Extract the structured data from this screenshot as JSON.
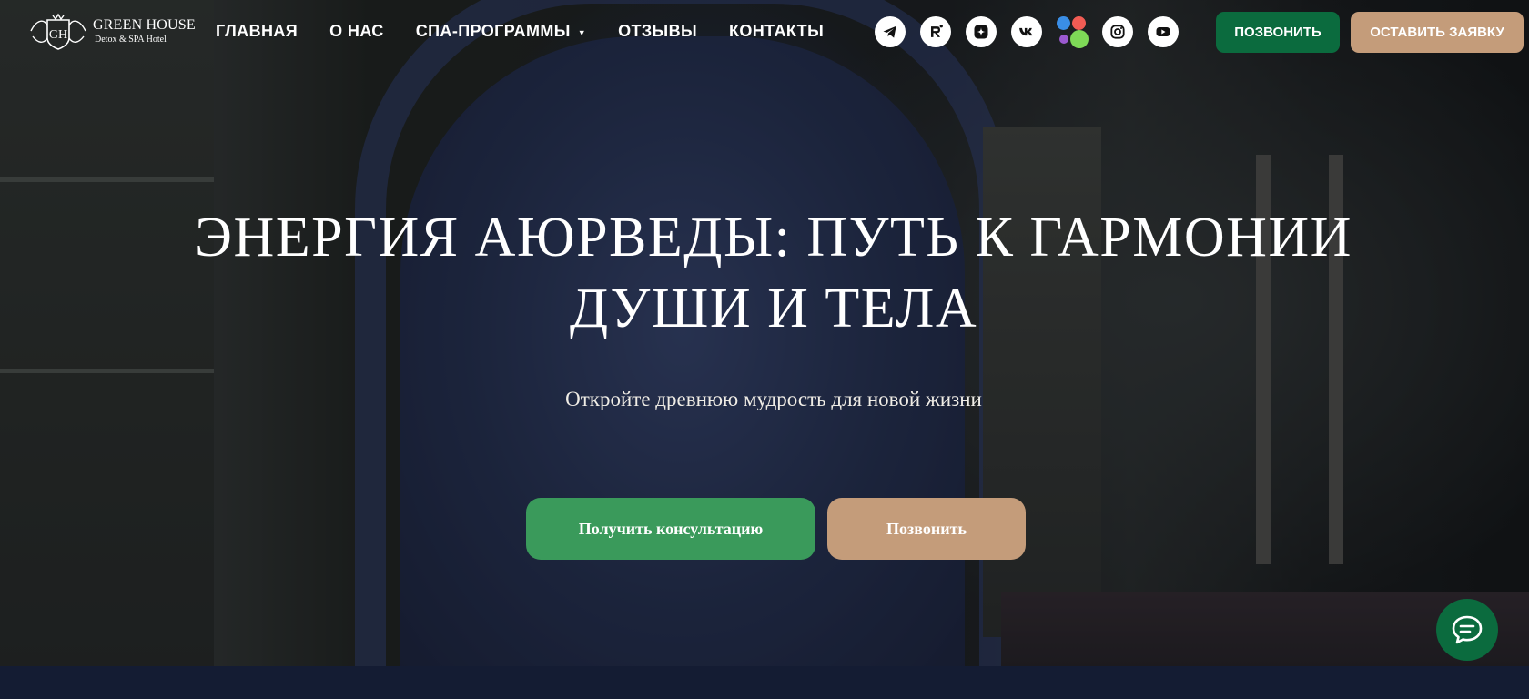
{
  "logo": {
    "name": "GREEN HOUSE",
    "subtitle": "Detox & SPA Hotel"
  },
  "nav": {
    "items": [
      {
        "label": "ГЛАВНАЯ"
      },
      {
        "label": "О НАС"
      },
      {
        "label": "СПА-ПРОГРАММЫ",
        "has_dropdown": true
      },
      {
        "label": "ОТЗЫВЫ"
      },
      {
        "label": "КОНТАКТЫ"
      }
    ],
    "caret": "▼"
  },
  "socials": [
    "telegram-icon",
    "rutube-icon",
    "dzen-icon",
    "vk-icon",
    "vk-services-icon",
    "instagram-icon",
    "youtube-icon"
  ],
  "header_buttons": {
    "call": "ПОЗВОНИТЬ",
    "apply": "ОСТАВИТЬ ЗАЯВКУ"
  },
  "hero": {
    "title_line1": "ЭНЕРГИЯ АЮРВЕДЫ: ПУТЬ К ГАРМОНИИ",
    "title_line2": "ДУШИ И ТЕЛА",
    "subtitle": "Откройте древнюю мудрость для новой жизни",
    "consult_button": "Получить консультацию",
    "call_button": "Позвонить"
  },
  "colors": {
    "green": "#0b6b3e",
    "green_light": "#3a9a5b",
    "beige": "#c49c7a",
    "navy": "#141c33"
  }
}
